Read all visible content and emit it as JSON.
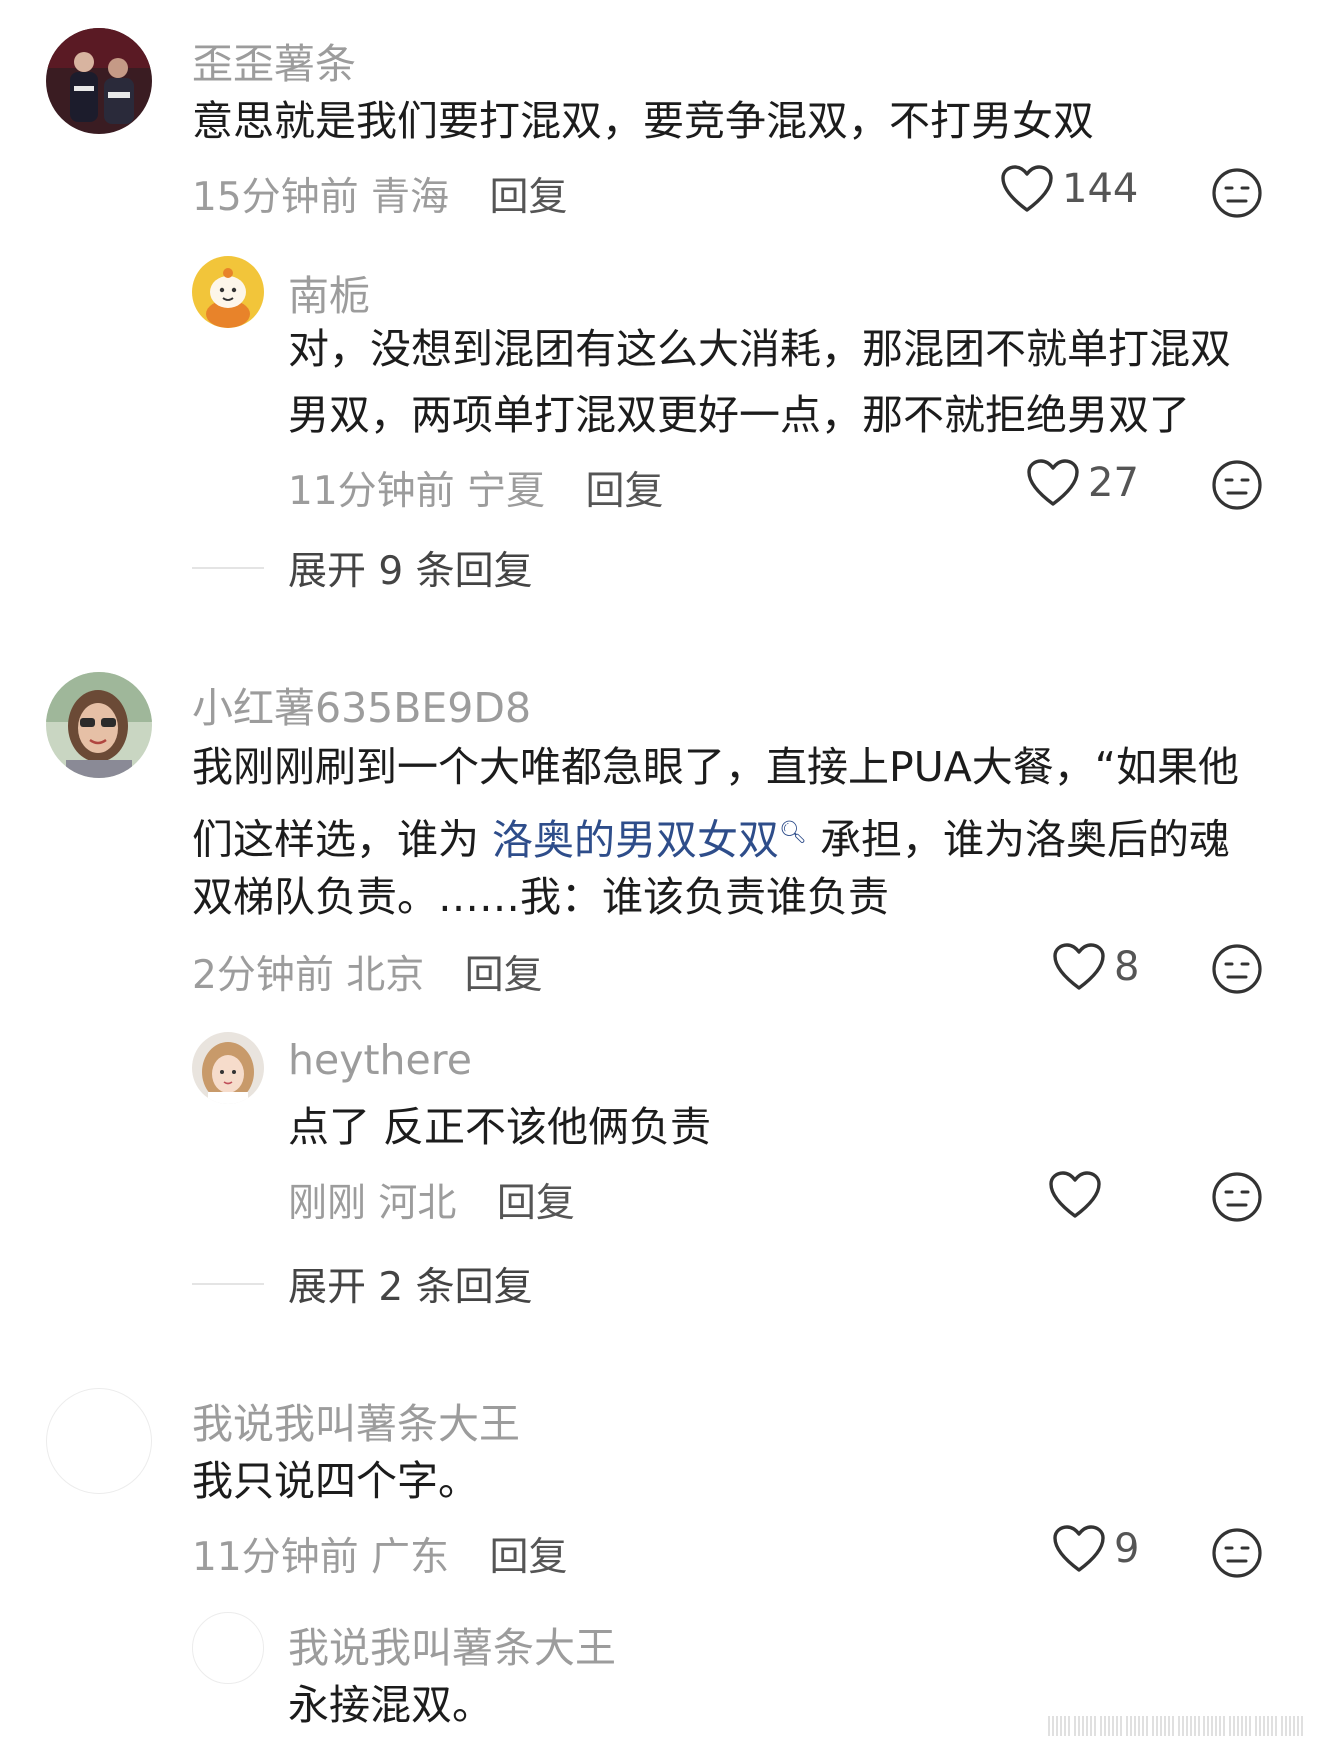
{
  "comments": [
    {
      "user": "歪歪薯条",
      "lines": [
        "意思就是我们要打混双，要竞争混双，不打男女双"
      ],
      "time": "15分钟前",
      "location": "青海",
      "reply_label": "回复",
      "likes": "144",
      "replies": [
        {
          "user": "南栀",
          "lines": [
            "对，没想到混团有这么大消耗，那混团不就单打混双",
            "男双，两项单打混双更好一点，那不就拒绝男双了"
          ],
          "time": "11分钟前",
          "location": "宁夏",
          "reply_label": "回复",
          "likes": "27"
        }
      ],
      "expand_label": "展开 9 条回复"
    },
    {
      "user": "小红薯635BE9D8",
      "line1": "我刚刚刷到一个大唯都急眼了，直接上PUA大餐，“如果他",
      "line2_pre": "们这样选，谁为",
      "line2_link": "洛奥的男双女双",
      "line2_post": "承担，谁为洛奥后的魂",
      "line3": "双梯队负责。……我：谁该负责谁负责",
      "time": "2分钟前",
      "location": "北京",
      "reply_label": "回复",
      "likes": "8",
      "replies": [
        {
          "user": "heythere",
          "lines": [
            "点了  反正不该他俩负责"
          ],
          "time": "刚刚",
          "location": "河北",
          "reply_label": "回复",
          "likes": ""
        }
      ],
      "expand_label": "展开 2 条回复"
    },
    {
      "user": "我说我叫薯条大王",
      "lines": [
        "我只说四个字。"
      ],
      "time": "11分钟前",
      "location": "广东",
      "reply_label": "回复",
      "likes": "9",
      "replies": [
        {
          "user": "我说我叫薯条大王",
          "lines": [
            "永接混双。"
          ]
        }
      ]
    }
  ],
  "icons": {
    "like": "heart-outline-icon",
    "dislike": "meh-face-icon",
    "search_link": "search-icon"
  },
  "colors": {
    "username": "#9c9c9c",
    "text": "#1c1c1c",
    "link": "#2e4d8a"
  }
}
